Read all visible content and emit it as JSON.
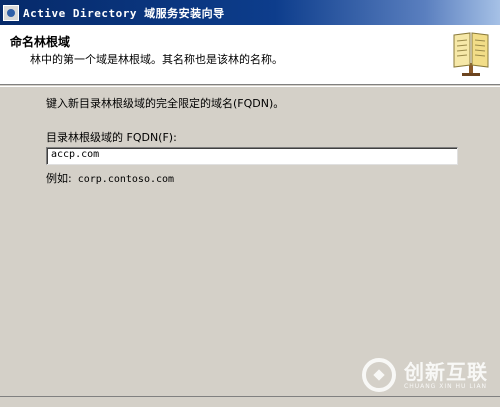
{
  "window": {
    "title": "Active Directory 域服务安装向导"
  },
  "header": {
    "title": "命名林根域",
    "subtitle": "林中的第一个域是林根域。其名称也是该林的名称。",
    "icon": "book-icon"
  },
  "content": {
    "lead": "键入新目录林根级域的完全限定的域名(FQDN)。",
    "fqdn_label": "目录林根级域的 FQDN(F):",
    "fqdn_value": "accp.com",
    "example_label": "例如:",
    "example_value": "corp.contoso.com"
  },
  "watermark": {
    "main": "创新互联",
    "small": "CHUANG XIN HU LIAN"
  },
  "colors": {
    "dialog_bg": "#d4d0c8",
    "title_bar": "#0d3d8c"
  }
}
